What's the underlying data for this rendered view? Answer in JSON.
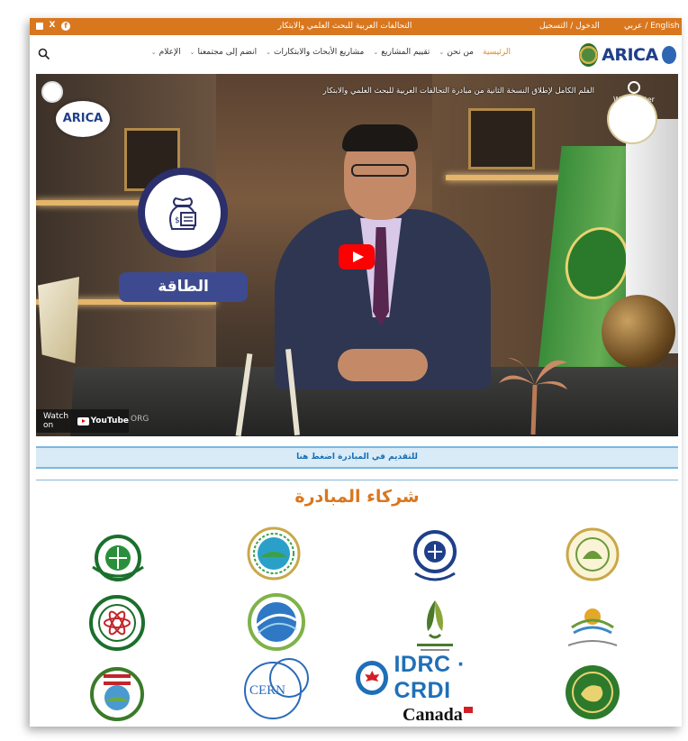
{
  "topbar": {
    "social_icons": [
      "instagram-icon",
      "x-icon",
      "facebook-icon"
    ],
    "site_title": "التحالفات العربية للبحث العلمي والابتكار",
    "auth_link": "الدخول / التسجيل",
    "language_switch": "عربي / English"
  },
  "nav": {
    "logo_text": "ARICA",
    "items": [
      {
        "label": "الرئيسية",
        "active": true,
        "has_dropdown": false
      },
      {
        "label": "من نحن",
        "active": false,
        "has_dropdown": true
      },
      {
        "label": "تقييم المشاريع",
        "active": false,
        "has_dropdown": true
      },
      {
        "label": "مشاريع الأبحاث والابتكارات",
        "active": false,
        "has_dropdown": true
      },
      {
        "label": "انضم إلى مجتمعنا",
        "active": false,
        "has_dropdown": true
      },
      {
        "label": "الإعلام",
        "active": false,
        "has_dropdown": true
      }
    ],
    "chevron": "⌄"
  },
  "video": {
    "title": "الفلم الكامل لإطلاق النسخة الثانية من مبادرة التحالفات العربية للبحث العلمي والابتكار",
    "watch_later": "Watch later",
    "card_label": "الطاقة",
    "badge_text": "ARICA",
    "watch_on": "Watch on",
    "youtube": "YouTube",
    "org_text": "ORG"
  },
  "apply_bar": {
    "text": "للتقديم في المبادرة اضغط هنا"
  },
  "partners": {
    "title": "شركاء المبادرة",
    "idrc_text": "IDRC · CRDI",
    "canada_text": "Canada",
    "cern_text": "CERN",
    "logos": [
      "partner-logo-1",
      "partner-logo-2",
      "partner-logo-3",
      "partner-logo-4",
      "partner-logo-5",
      "partner-logo-6",
      "partner-logo-7",
      "partner-logo-8",
      "partner-logo-9",
      "partner-logo-10"
    ]
  },
  "colors": {
    "brand_orange": "#d9771f",
    "nav_active": "#e08a25",
    "apply_bg": "#d8ebf7",
    "apply_text": "#1a6fb3"
  }
}
